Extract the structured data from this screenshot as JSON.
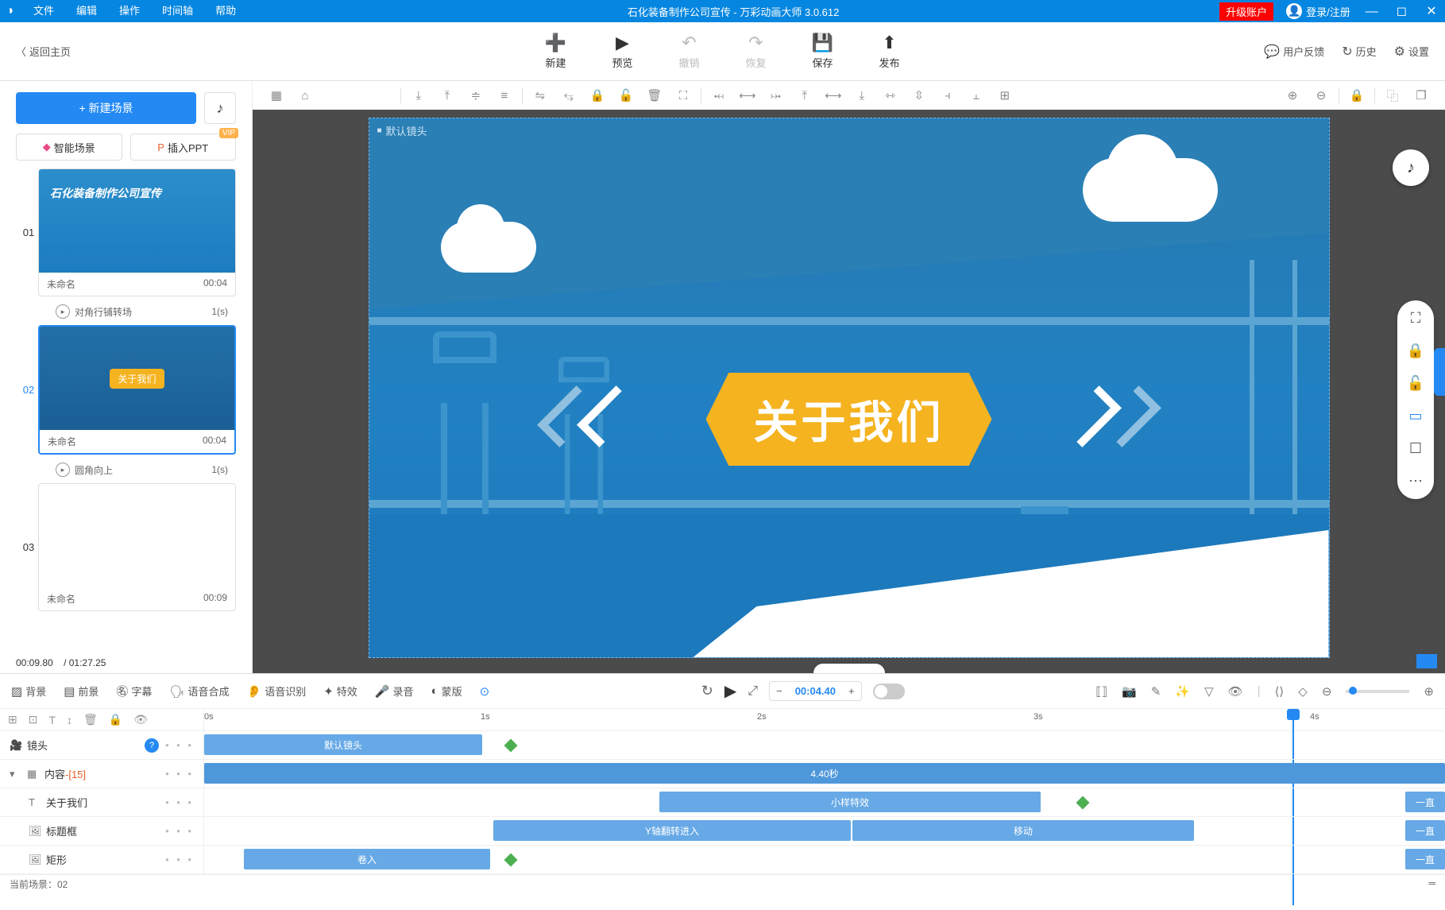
{
  "titlebar": {
    "menus": [
      "文件",
      "编辑",
      "操作",
      "时间轴",
      "帮助"
    ],
    "title": "石化装备制作公司宣传 - 万彩动画大师 3.0.612",
    "upgrade": "升级账户",
    "login": "登录/注册"
  },
  "topbar": {
    "back": "返回主页",
    "buttons": [
      {
        "label": "新建",
        "disabled": false
      },
      {
        "label": "预览",
        "disabled": false
      },
      {
        "label": "撤销",
        "disabled": true
      },
      {
        "label": "恢复",
        "disabled": true
      },
      {
        "label": "保存",
        "disabled": false
      },
      {
        "label": "发布",
        "disabled": false
      }
    ],
    "right": [
      {
        "label": "用户反馈"
      },
      {
        "label": "历史"
      },
      {
        "label": "设置"
      }
    ]
  },
  "sidebar": {
    "new_scene": "+  新建场景",
    "ai_scene": "智能场景",
    "import_ppt": "插入PPT",
    "vip": "VIP",
    "current_time": "00:09.80",
    "total_time": "/ 01:27.25",
    "scenes": [
      {
        "num": "01",
        "name": "未命名",
        "time": "00:04",
        "trans": "对角行铺转场",
        "trans_time": "1(s)"
      },
      {
        "num": "02",
        "name": "未命名",
        "time": "00:04",
        "trans": "圆角向上",
        "trans_time": "1(s)"
      },
      {
        "num": "03",
        "name": "未命名",
        "time": "00:09"
      }
    ]
  },
  "canvas": {
    "camera_label": "默认镜头",
    "about_text": "关于我们",
    "mini_about": "关于我们"
  },
  "timeline": {
    "tool_buttons": [
      "背景",
      "前景",
      "字幕",
      "语音合成",
      "语音识别",
      "特效",
      "录音",
      "蒙版"
    ],
    "time_value": "00:04.40",
    "ruler": [
      "0s",
      "1s",
      "2s",
      "3s",
      "4s"
    ],
    "tracks": [
      {
        "icon": "🎥",
        "name": "镜头"
      },
      {
        "icon": "📁",
        "name": "内容",
        "suffix": "-[15]"
      },
      {
        "icon": "T",
        "name": "关于我们"
      },
      {
        "icon": "🖼",
        "name": "标题框"
      },
      {
        "icon": "🖼",
        "name": "矩形"
      }
    ],
    "clips": {
      "camera": "默认镜头",
      "content": "4.40秒",
      "text_effect": "小样特效",
      "always": "一直",
      "title_in": "Y轴翻转进入",
      "title_move": "移动",
      "rect_in": "卷入"
    }
  },
  "status": {
    "left": "当前场景：02"
  }
}
